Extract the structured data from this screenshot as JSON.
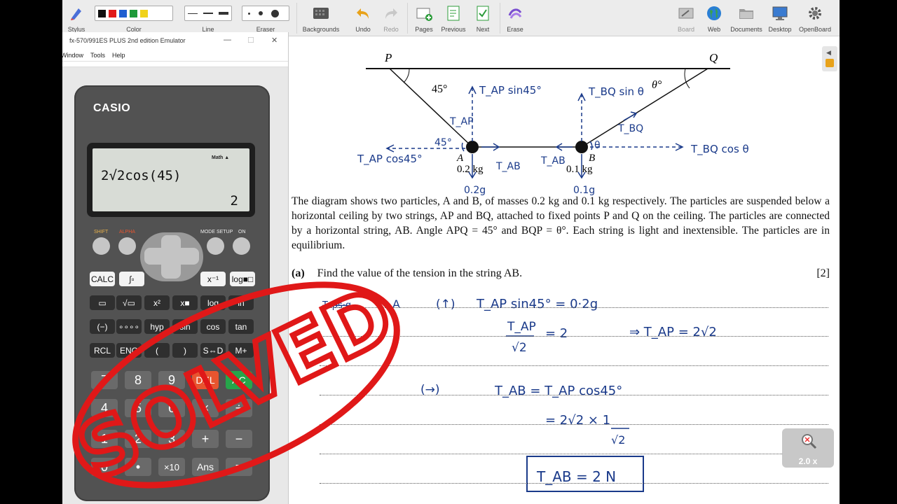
{
  "toolbar": {
    "stylus": "Stylus",
    "color": "Color",
    "line": "Line",
    "eraser": "Eraser",
    "backgrounds": "Backgrounds",
    "undo": "Undo",
    "redo": "Redo",
    "pages": "Pages",
    "previous": "Previous",
    "next": "Next",
    "erase": "Erase",
    "board": "Board",
    "web": "Web",
    "documents": "Documents",
    "desktop": "Desktop",
    "openboard": "OpenBoard",
    "colors": [
      "#111111",
      "#e11b1b",
      "#1f5fd1",
      "#1f9a3a",
      "#f0d21a"
    ]
  },
  "calculator": {
    "window_title": "fx-570/991ES PLUS 2nd edition Emulator",
    "menu": [
      "Window",
      "Tools",
      "Help"
    ],
    "brand": "CASIO",
    "display": {
      "indicator": "Math ▲",
      "expression": "2√2cos(45)",
      "result": "2"
    },
    "keys": {
      "shift": "SHIFT",
      "alpha": "ALPHA",
      "mode": "MODE SETUP",
      "on": "ON",
      "calc": "CALC",
      "logx": "log■□",
      "x_inv": "x⁻¹",
      "frac": "▭",
      "sqrt": "√▭",
      "sq": "x²",
      "pow": "x■",
      "log": "log",
      "ln": "ln",
      "neg": "(−)",
      "deg": "∘∘∘∘",
      "hyp": "hyp",
      "sin": "sin",
      "cos": "cos",
      "tan": "tan",
      "rcl": "RCL",
      "eng": "ENG",
      "lpar": "(",
      "rpar": ")",
      "sd": "S⇔D",
      "mplus": "M+",
      "n7": "7",
      "n8": "8",
      "n9": "9",
      "del": "DEL",
      "ac": "AC",
      "n4": "4",
      "n5": "5",
      "n6": "6",
      "mul": "×",
      "div": "÷",
      "n1": "1",
      "n2": "2",
      "n3": "3",
      "plus": "+",
      "minus": "−",
      "n0": "0",
      "dot": "•",
      "x10": "×10",
      "ans": "Ans",
      "eq": "="
    }
  },
  "diagram": {
    "P": "P",
    "Q": "Q",
    "A": "A",
    "B": "B",
    "angle_p": "45°",
    "angle_q": "θ°",
    "mass_a": "0.2 kg",
    "mass_b": "0.1 kg"
  },
  "annotations": {
    "tap_sin": "T_AP sin45°",
    "tbq_sin": "T_BQ sin θ",
    "tap": "T_AP",
    "tbq": "T_BQ",
    "tap_cos": "T_AP cos45°",
    "tbq_cos": "T_BQ cos θ",
    "tab_a": "T_AB",
    "tab_b": "T_AB",
    "ang45": "45°",
    "theta": "θ",
    "w_a": "0.2g",
    "w_b": "0.1g"
  },
  "question": {
    "paragraph": "The diagram shows two particles, A and B, of masses 0.2 kg and 0.1 kg respectively. The particles are suspended below a horizontal ceiling by two strings, AP and BQ, attached to fixed points P and Q on the ceiling. The particles are connected by a horizontal string, AB. Angle APQ = 45° and BQP = θ°. Each string is light and inextensible. The particles are in equilibrium.",
    "part": "(a)",
    "prompt": "Find the value of the tension in the string AB.",
    "marks": "[2]"
  },
  "working": {
    "l1_label": "A",
    "l1_dir": "(↑)",
    "l1": "T_AP sin45°  =  0·2g",
    "l2a": "T_AP",
    "l2b": "√2",
    "l2c": "=  2",
    "l2d": "⇒  T_AP = 2√2",
    "l3_dir": "(→)",
    "l3": "T_AB  =  T_AP cos45°",
    "l4": "= 2√2 × 1",
    "l4b": "√2",
    "l5": "T_AB  =  2 N"
  },
  "stamp": "SOLVED",
  "zoom": "2.0 x"
}
